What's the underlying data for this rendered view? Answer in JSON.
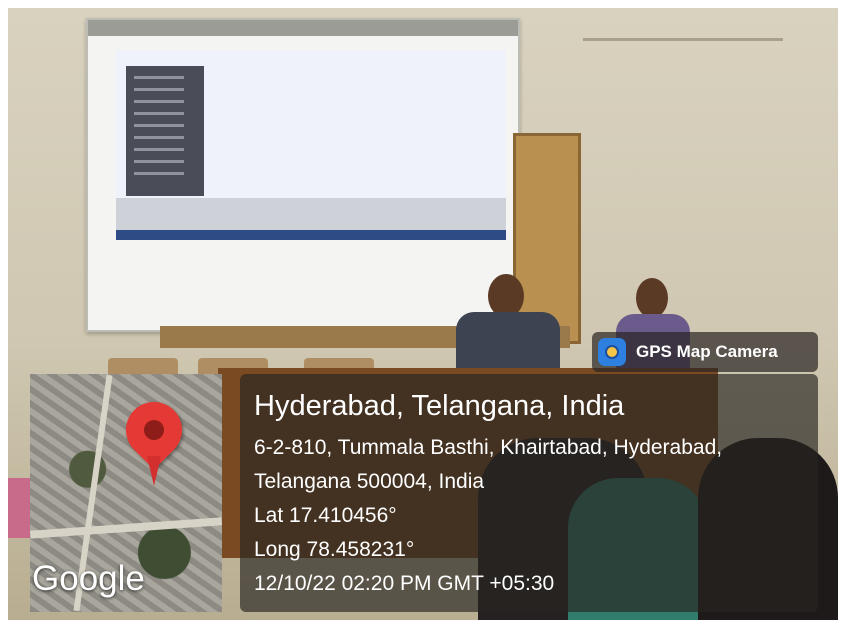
{
  "overlay": {
    "app_badge": "GPS Map Camera",
    "city": "Hyderabad, Telangana, India",
    "address_line_1": "6-2-810, Tummala Basthi, Khairtabad, Hyderabad,",
    "address_line_2": "Telangana 500004, India",
    "latitude": "Lat 17.410456°",
    "longitude": "Long 78.458231°",
    "timestamp": "12/10/22 02:20 PM GMT +05:30",
    "map_brand": "Google"
  },
  "icons": [
    "map-pin-icon",
    "gps-camera-icon"
  ],
  "colors": {
    "pin": "#e53935",
    "panel": "#2c2826",
    "text": "#ffffff",
    "camera_icon": "#2d7fe0"
  }
}
